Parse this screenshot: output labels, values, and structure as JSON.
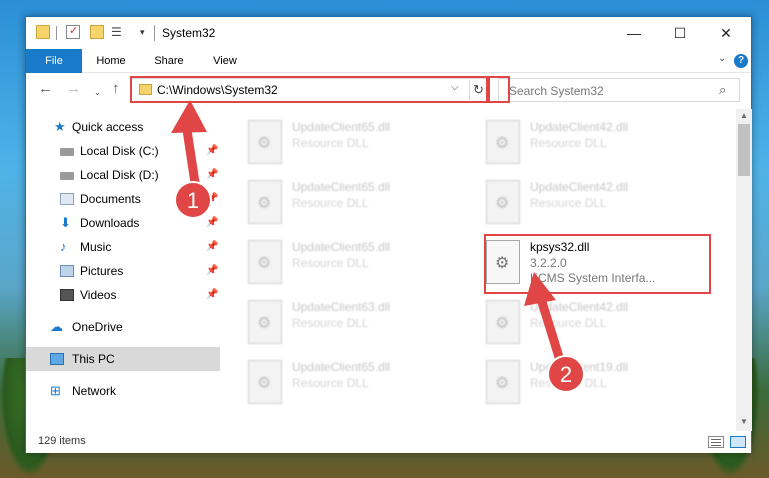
{
  "window": {
    "title": "System32",
    "controls": {
      "minimize": "—",
      "maximize": "☐",
      "close": "✕"
    }
  },
  "ribbon": {
    "tabs": [
      "File",
      "Home",
      "Share",
      "View"
    ],
    "help": "?"
  },
  "address_bar": {
    "path": "C:\\Windows\\System32",
    "dropdown": "⌵",
    "refresh": "↻"
  },
  "search": {
    "placeholder": "Search System32",
    "icon": "⌕"
  },
  "navigation": {
    "back": "←",
    "forward": "→",
    "recent": "⌄",
    "up": "↑"
  },
  "sidebar": {
    "items": [
      {
        "label": "Quick access",
        "icon": "star-icon",
        "pinned": false
      },
      {
        "label": "Local Disk (C:)",
        "icon": "disk-icon",
        "pinned": true
      },
      {
        "label": "Local Disk (D:)",
        "icon": "disk-icon",
        "pinned": true
      },
      {
        "label": "Documents",
        "icon": "documents-icon",
        "pinned": true
      },
      {
        "label": "Downloads",
        "icon": "download-icon",
        "pinned": true
      },
      {
        "label": "Music",
        "icon": "music-icon",
        "pinned": true
      },
      {
        "label": "Pictures",
        "icon": "pictures-icon",
        "pinned": true
      },
      {
        "label": "Videos",
        "icon": "videos-icon",
        "pinned": true
      },
      {
        "label": "OneDrive",
        "icon": "cloud-icon",
        "pinned": false
      },
      {
        "label": "This PC",
        "icon": "computer-icon",
        "pinned": false,
        "selected": true
      },
      {
        "label": "Network",
        "icon": "network-icon",
        "pinned": false
      }
    ],
    "pin_glyph": "📌"
  },
  "files": [
    {
      "name": "UpdateClient65.dll",
      "desc": "Resource DLL"
    },
    {
      "name": "UpdateClient42.dll",
      "desc": "Resource DLL"
    },
    {
      "name": "UpdateClient65.dll",
      "desc": "Resource DLL"
    },
    {
      "name": "UpdateClient42.dll",
      "desc": "Resource DLL"
    },
    {
      "name": "UpdateClient65.dll",
      "desc": "Resource DLL"
    },
    {
      "name": "kpsys32.dll",
      "version": "3.2.2.0",
      "desc": "KCMS System Interfa...",
      "highlighted": true
    },
    {
      "name": "UpdateClient63.dll",
      "desc": "Resource DLL"
    },
    {
      "name": "UpdateClient42.dll",
      "desc": "Resource DLL"
    },
    {
      "name": "UpdateClient65.dll",
      "desc": "Resource DLL"
    },
    {
      "name": "UpdateClient19.dll",
      "desc": "Resource DLL"
    }
  ],
  "status": {
    "item_count": "129 items"
  },
  "annotations": {
    "step1": "1",
    "step2": "2",
    "color": "#e04646"
  }
}
